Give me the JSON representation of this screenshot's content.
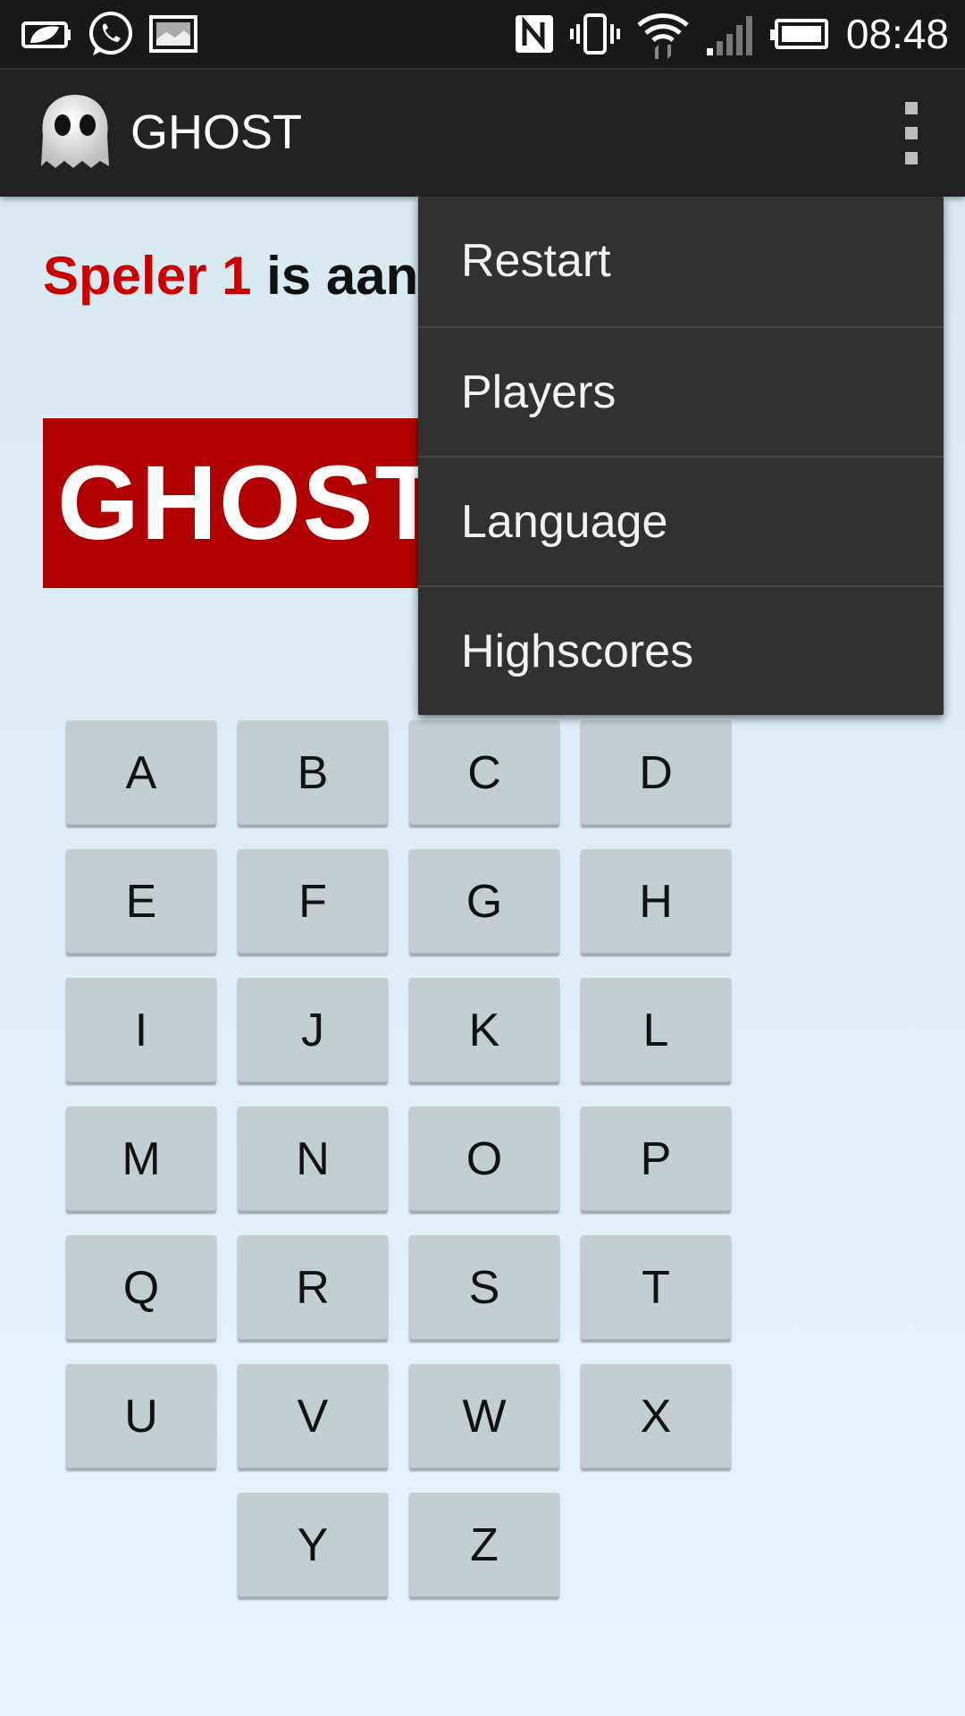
{
  "status_bar": {
    "time": "08:48",
    "icons": [
      "battery-saver-icon",
      "whatsapp-icon",
      "gallery-icon",
      "nfc-icon",
      "vibrate-icon",
      "wifi-icon",
      "signal-icon",
      "battery-icon"
    ]
  },
  "action_bar": {
    "title": "GHOST",
    "logo_icon": "ghost-logo-icon",
    "overflow_icon": "overflow-menu-icon"
  },
  "game": {
    "player_name": "Speler 1",
    "turn_text": " is aan z",
    "word": "GHOST"
  },
  "keyboard": {
    "keys": [
      "A",
      "B",
      "C",
      "D",
      "E",
      "F",
      "G",
      "H",
      "I",
      "J",
      "K",
      "L",
      "M",
      "N",
      "O",
      "P",
      "Q",
      "R",
      "S",
      "T",
      "U",
      "V",
      "W",
      "X",
      "Y",
      "Z"
    ]
  },
  "menu": {
    "items": [
      {
        "label": "Restart"
      },
      {
        "label": "Players"
      },
      {
        "label": "Language"
      },
      {
        "label": "Highscores"
      }
    ]
  },
  "colors": {
    "accent_red": "#cc0000",
    "banner_red": "#b00000",
    "menu_bg": "#313131",
    "action_bar_bg": "#222222",
    "key_bg": "#c3ced3"
  }
}
